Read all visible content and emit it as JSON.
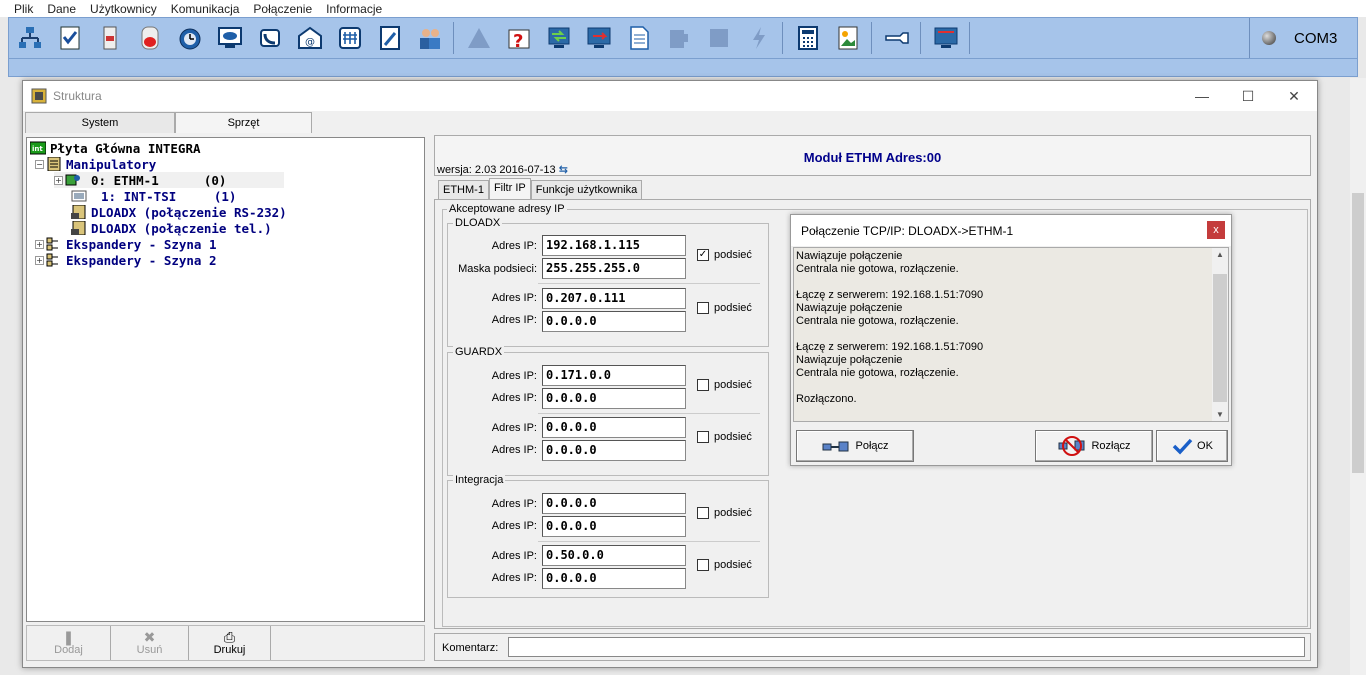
{
  "menu": [
    "Plik",
    "Dane",
    "Użytkownicy",
    "Komunikacja",
    "Połączenie",
    "Informacje"
  ],
  "toolbar": {
    "port_label": "COM3",
    "icons": [
      "structure-icon",
      "checklist-icon",
      "module-icon",
      "siren-icon",
      "clock-icon",
      "eye-monitor-icon",
      "phone-icon",
      "email-icon",
      "keypad-icon",
      "tools-icon",
      "users-icon",
      "triangle-icon",
      "question-icon",
      "transfer-icon",
      "monitor-arrow-icon",
      "document-icon",
      "puzzle-icon",
      "square-icon",
      "lightning-icon",
      "calculator-icon",
      "image-icon",
      "wrench-icon",
      "screen-icon"
    ]
  },
  "struktura": {
    "title": "Struktura",
    "tabs": [
      "System",
      "Sprzęt"
    ],
    "tree": [
      {
        "label": "Płyta Główna INTEGRA",
        "color": "#000"
      },
      {
        "label": "Manipulatory",
        "color": "#00007f"
      },
      {
        "label": "0: ETHM-1      (0)",
        "color": "#000"
      },
      {
        "label": "1: INT-TSI     (1)",
        "color": "#00007f"
      },
      {
        "label": "DLOADX (połączenie RS-232)",
        "color": "#00007f"
      },
      {
        "label": "DLOADX (połączenie tel.)",
        "color": "#00007f"
      },
      {
        "label": "Ekspandery - Szyna 1",
        "color": "#00007f"
      },
      {
        "label": "Ekspandery - Szyna 2",
        "color": "#00007f"
      }
    ],
    "buttons": [
      "Dodaj",
      "Usuń",
      "Drukuj"
    ]
  },
  "module": {
    "title": "Moduł ETHM Adres:00",
    "version": "wersja: 2.03 2016-07-13",
    "tabs": [
      "ETHM-1",
      "Filtr IP",
      "Funkcje użytkownika"
    ],
    "accepted_label": "Akceptowane adresy IP",
    "groups": {
      "dloadx": "DLOADX",
      "guardx": "GUARDX",
      "integracja": "Integracja"
    },
    "labels": {
      "adres_ip": "Adres IP:",
      "maska": "Maska podsieci:",
      "podsiec": "podsieć"
    },
    "values": {
      "d1_ip": "192.168.1.115",
      "d1_mask": "255.255.255.0",
      "d2_ip1": "0.207.0.111",
      "d2_ip2": "0.0.0.0",
      "g1_ip1": "0.171.0.0",
      "g1_ip2": "0.0.0.0",
      "g2_ip1": "0.0.0.0",
      "g2_ip2": "0.0.0.0",
      "i1_ip1": "0.0.0.0",
      "i1_ip2": "0.0.0.0",
      "i2_ip1": "0.50.0.0",
      "i2_ip2": "0.0.0.0"
    },
    "comment_label": "Komentarz:"
  },
  "dialog": {
    "title": "Połączenie TCP/IP: DLOADX->ETHM-1",
    "close": "x",
    "log": "Nawiązuje połączenie\nCentrala nie gotowa, rozłączenie.\n\nŁączę z serwerem: 192.168.1.51:7090\nNawiązuje połączenie\nCentrala nie gotowa, rozłączenie.\n\nŁączę z serwerem: 192.168.1.51:7090\nNawiązuje połączenie\nCentrala nie gotowa, rozłączenie.\n\nRozłączono.",
    "btn_connect": "Połącz",
    "btn_disconnect": "Rozłącz",
    "btn_ok": "OK"
  },
  "colors": {
    "toolbar": "#a6c4ea",
    "title_blue": "#00008b",
    "check_ok": "#1a5fc8"
  }
}
